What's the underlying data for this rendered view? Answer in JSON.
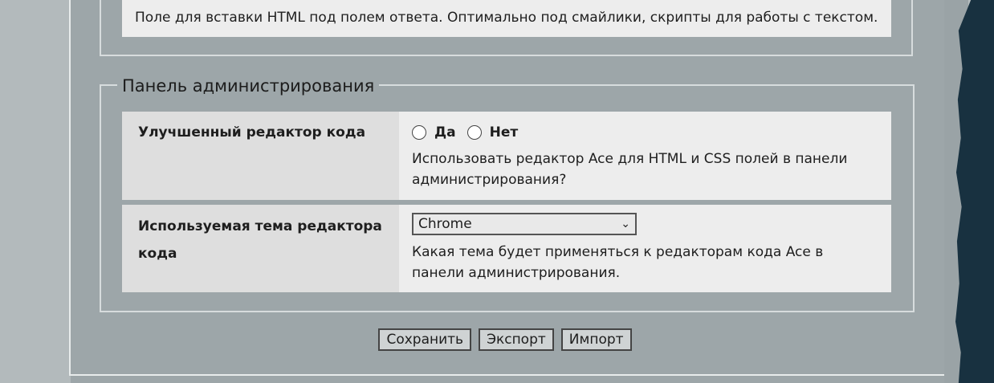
{
  "top_note": "Поле для вставки HTML под полем ответа. Оптимально под смайлики, скрипты для работы с текстом.",
  "admin_panel": {
    "legend": "Панель администрирования",
    "code_editor": {
      "label": "Улучшенный редактор кода",
      "option_yes": "Да",
      "option_no": "Нет",
      "description": "Использовать редактор Ace для HTML и CSS полей в панели администрирования?"
    },
    "editor_theme": {
      "label": "Используемая тема редактора кода",
      "selected": "Chrome",
      "description": "Какая тема будет применяться к редакторам кода Ace в панели администрирования."
    }
  },
  "buttons": {
    "save": "Сохранить",
    "export": "Экспорт",
    "import": "Импорт"
  }
}
